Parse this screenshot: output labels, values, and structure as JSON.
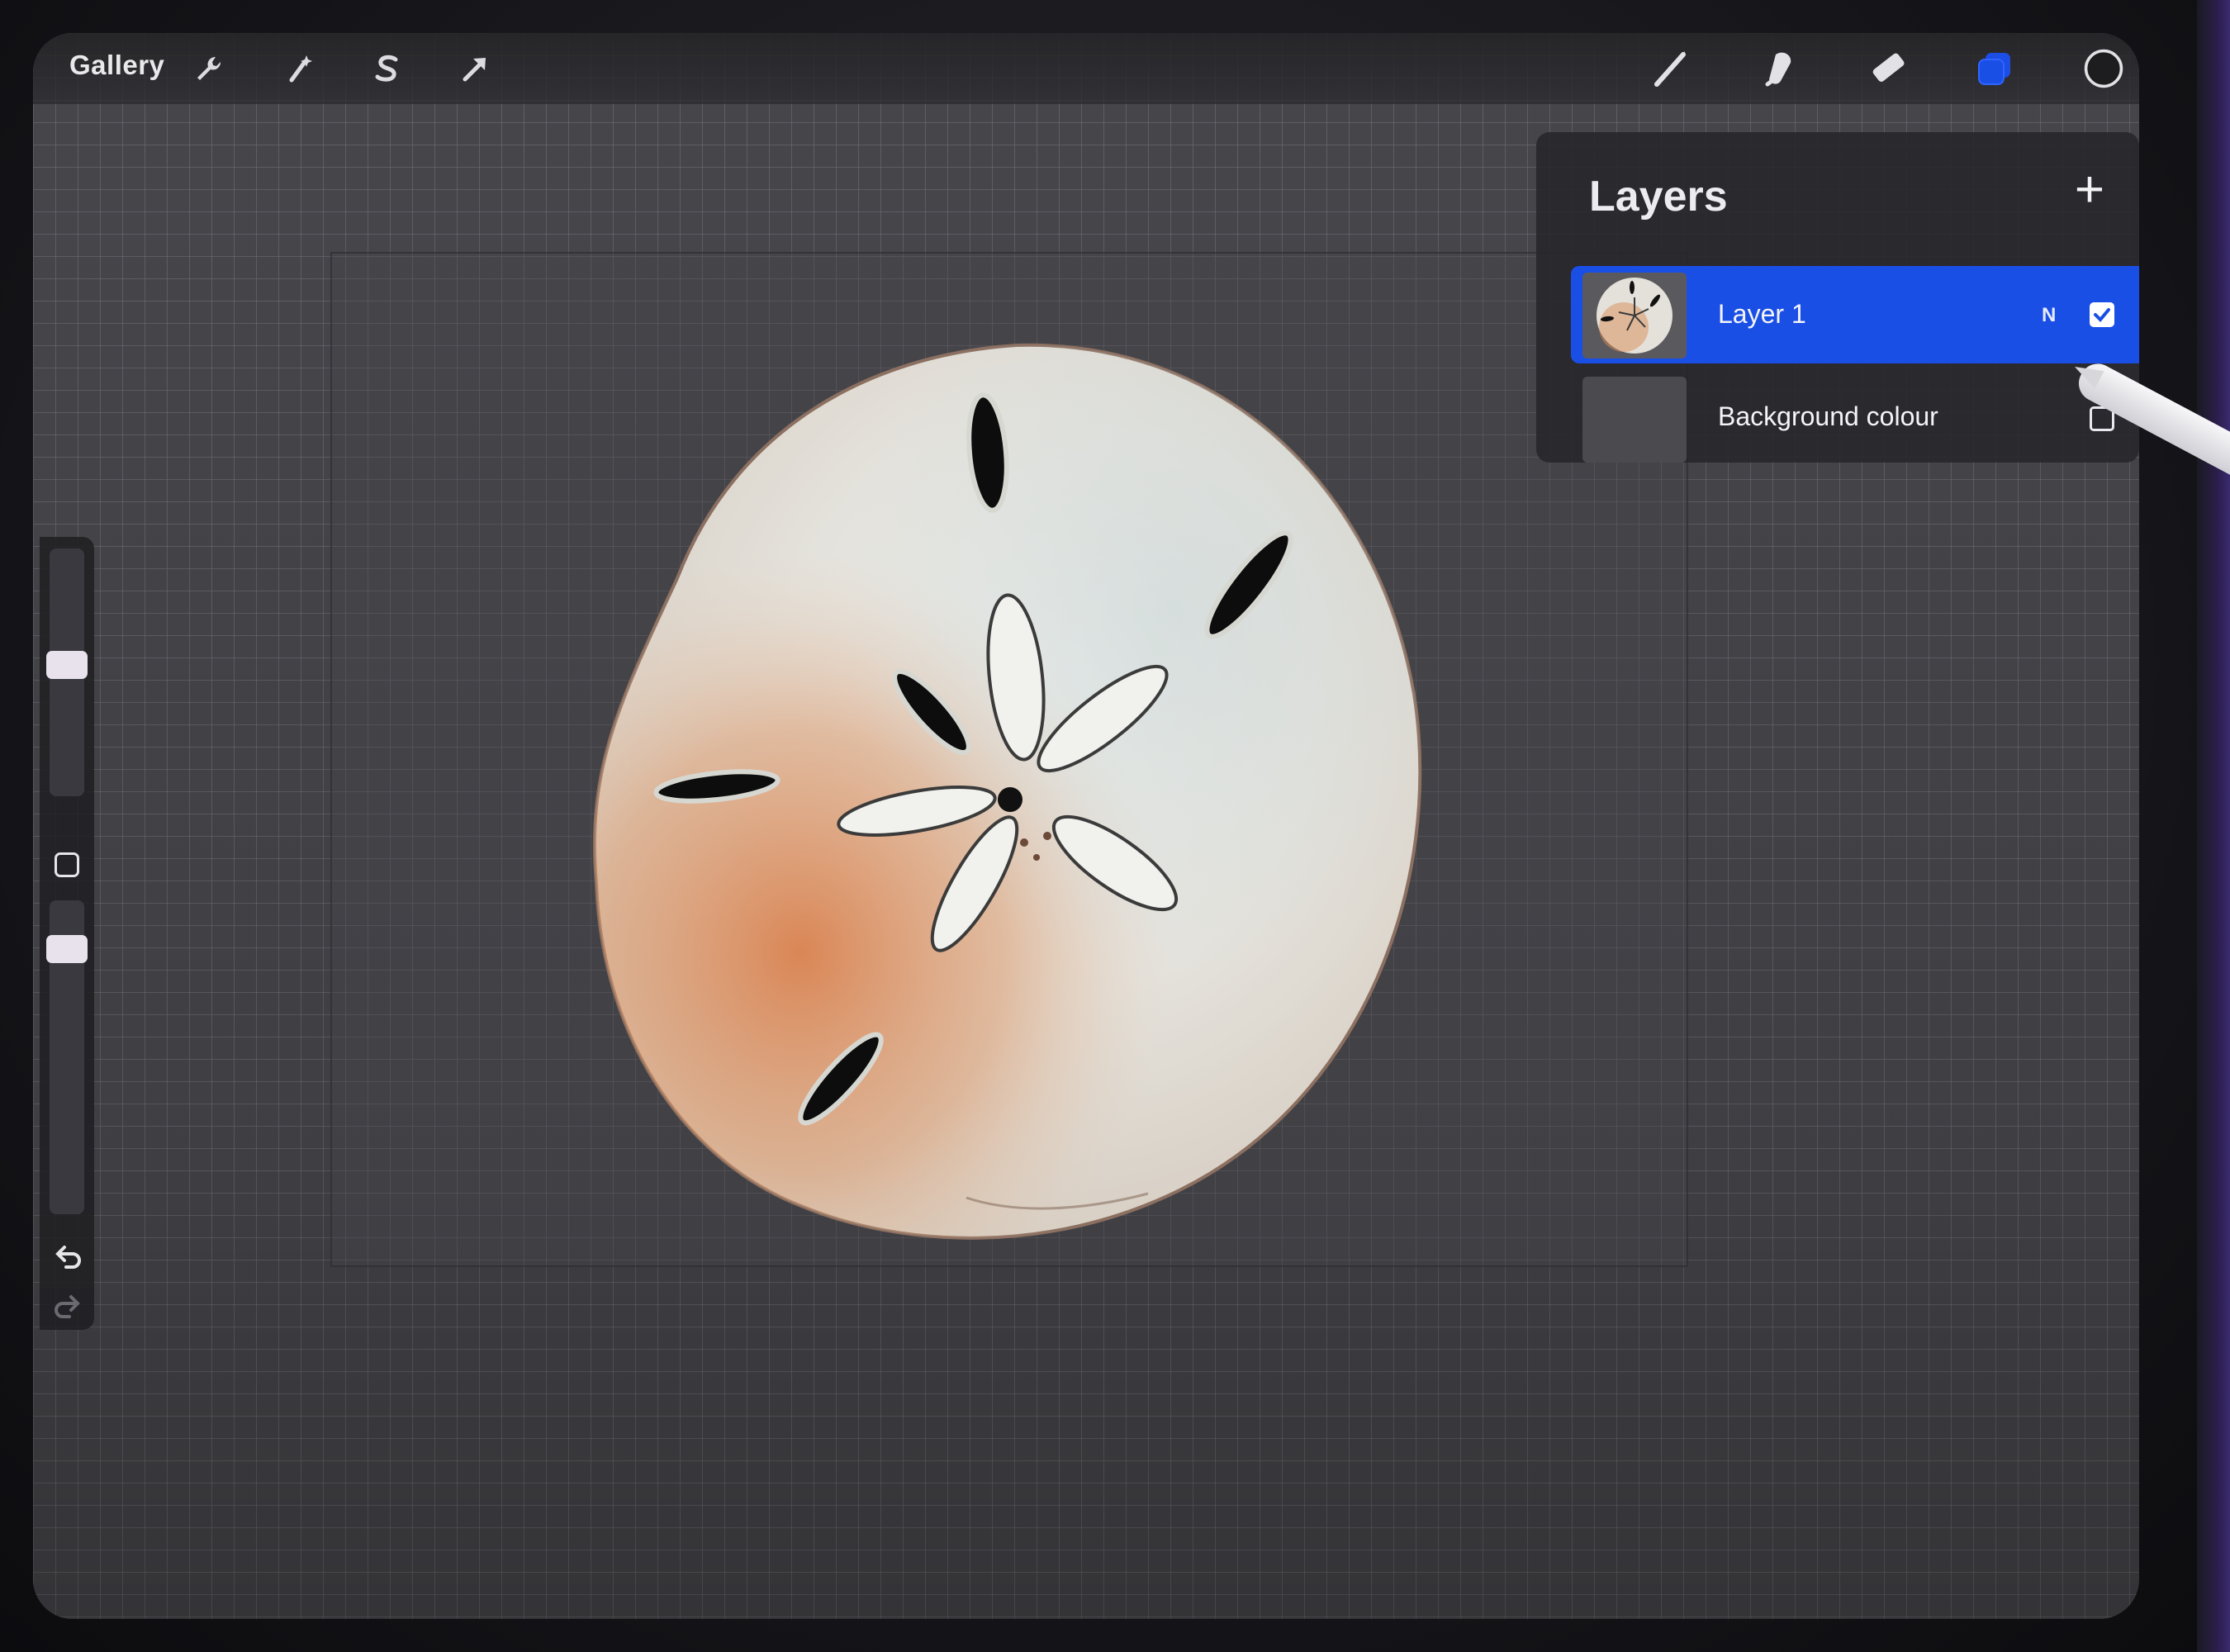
{
  "toolbar": {
    "gallery_label": "Gallery",
    "left_tools": [
      "wrench-icon",
      "magic-wand-icon",
      "selection-s-icon",
      "transform-arrow-icon"
    ],
    "right_tools": [
      "brush-icon",
      "smudge-icon",
      "eraser-icon",
      "layers-icon",
      "color-circle-icon"
    ],
    "accent_color": "#1a4fe6"
  },
  "layers_panel": {
    "title": "Layers",
    "add_label": "+",
    "layers": [
      {
        "name": "Layer 1",
        "blend_mode": "N",
        "visible": true,
        "selected": true
      },
      {
        "name": "Background colour",
        "visible": false,
        "selected": false
      }
    ]
  },
  "sidebar": {
    "brush_size": 0.55,
    "opacity": 0.85
  },
  "artwork": {
    "subject": "sand-dollar-watercolor"
  }
}
